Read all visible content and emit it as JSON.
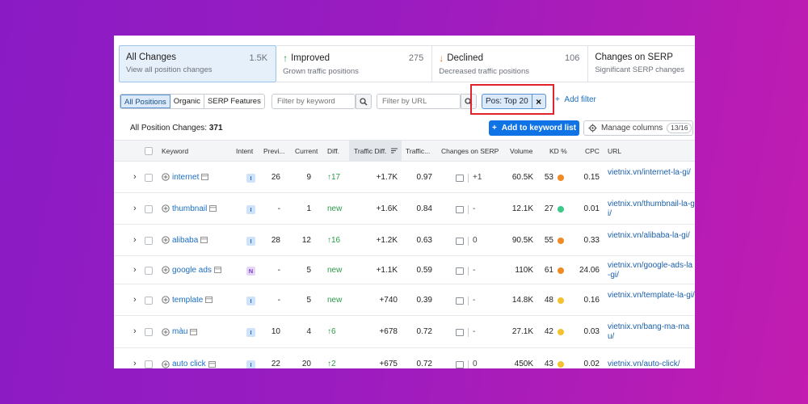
{
  "cards": [
    {
      "title": "All Changes",
      "count": "1.5K",
      "sub": "View all position changes",
      "arrow": "",
      "active": true
    },
    {
      "title": "Improved",
      "count": "275",
      "sub": "Grown traffic positions",
      "arrow": "up",
      "active": false
    },
    {
      "title": "Declined",
      "count": "106",
      "sub": "Decreased traffic positions",
      "arrow": "down",
      "active": false
    },
    {
      "title": "Changes on SERP",
      "count": "",
      "sub": "Significant SERP changes",
      "arrow": "",
      "active": false
    }
  ],
  "filters": {
    "segments": [
      "All Positions",
      "Organic",
      "SERP Features"
    ],
    "keyword_placeholder": "Filter by keyword",
    "url_placeholder": "Filter by URL",
    "position_chip": "Pos: Top 20",
    "add_filter": "Add filter"
  },
  "toolbar": {
    "count_label": "All Position Changes:",
    "count_value": "371",
    "add_keyword_list": "Add to keyword list",
    "manage_columns": "Manage columns",
    "columns_badge": "13/16"
  },
  "columns": {
    "keyword": "Keyword",
    "intent": "Intent",
    "previous": "Previ...",
    "current": "Current",
    "diff": "Diff.",
    "traffic_diff": "Traffic Diff.",
    "traffic": "Traffic...",
    "changes_serp": "Changes on SERP",
    "volume": "Volume",
    "kd": "KD %",
    "cpc": "CPC",
    "url": "URL"
  },
  "colors": {
    "kd_orange": "#f08a24",
    "kd_green": "#3cc98a",
    "kd_yellow": "#f2c230",
    "accent": "#0f73e6"
  },
  "rows": [
    {
      "keyword": "internet",
      "intent": "I",
      "previous": "26",
      "current": "9",
      "diff": "↑17",
      "diff_type": "up",
      "traffic_diff": "+1.7K",
      "traffic": "0.97",
      "serp": "+1",
      "volume": "60.5K",
      "kd": "53",
      "kd_color": "#f08a24",
      "cpc": "0.15",
      "url": "vietnix.vn/internet-la-gi/"
    },
    {
      "keyword": "thumbnail",
      "intent": "I",
      "previous": "-",
      "current": "1",
      "diff": "new",
      "diff_type": "new",
      "traffic_diff": "+1.6K",
      "traffic": "0.84",
      "serp": "-",
      "volume": "12.1K",
      "kd": "27",
      "kd_color": "#3cc98a",
      "cpc": "0.01",
      "url": "vietnix.vn/thumbnail-la-gi/"
    },
    {
      "keyword": "alibaba",
      "intent": "I",
      "previous": "28",
      "current": "12",
      "diff": "↑16",
      "diff_type": "up",
      "traffic_diff": "+1.2K",
      "traffic": "0.63",
      "serp": "0",
      "volume": "90.5K",
      "kd": "55",
      "kd_color": "#f08a24",
      "cpc": "0.33",
      "url": "vietnix.vn/alibaba-la-gi/"
    },
    {
      "keyword": "google ads",
      "intent": "N",
      "previous": "-",
      "current": "5",
      "diff": "new",
      "diff_type": "new",
      "traffic_diff": "+1.1K",
      "traffic": "0.59",
      "serp": "-",
      "volume": "110K",
      "kd": "61",
      "kd_color": "#f08a24",
      "cpc": "24.06",
      "url": "vietnix.vn/google-ads-la-gi/"
    },
    {
      "keyword": "template",
      "intent": "I",
      "previous": "-",
      "current": "5",
      "diff": "new",
      "diff_type": "new",
      "traffic_diff": "+740",
      "traffic": "0.39",
      "serp": "-",
      "volume": "14.8K",
      "kd": "48",
      "kd_color": "#f2c230",
      "cpc": "0.16",
      "url": "vietnix.vn/template-la-gi/"
    },
    {
      "keyword": "màu",
      "intent": "I",
      "previous": "10",
      "current": "4",
      "diff": "↑6",
      "diff_type": "up",
      "traffic_diff": "+678",
      "traffic": "0.72",
      "serp": "-",
      "volume": "27.1K",
      "kd": "42",
      "kd_color": "#f2c230",
      "cpc": "0.03",
      "url": "vietnix.vn/bang-ma-mau/"
    },
    {
      "keyword": "auto click",
      "intent": "I",
      "previous": "22",
      "current": "20",
      "diff": "↑2",
      "diff_type": "up",
      "traffic_diff": "+675",
      "traffic": "0.72",
      "serp": "0",
      "volume": "450K",
      "kd": "43",
      "kd_color": "#f2c230",
      "cpc": "0.02",
      "url": "vietnix.vn/auto-click/"
    }
  ]
}
